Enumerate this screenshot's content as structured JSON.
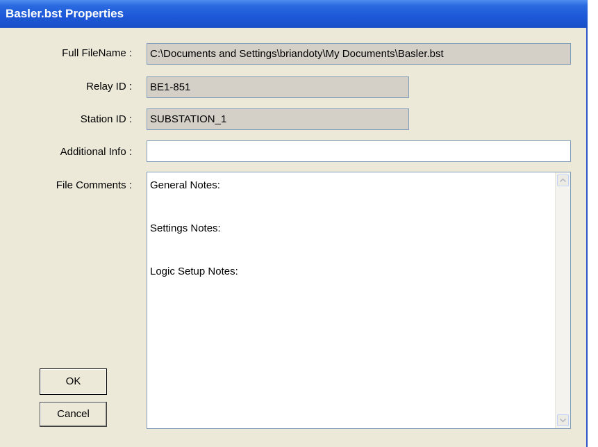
{
  "window": {
    "title": "Basler.bst Properties"
  },
  "fields": {
    "full_filename": {
      "label": "Full FileName :",
      "value": "C:\\Documents and Settings\\briandoty\\My Documents\\Basler.bst"
    },
    "relay_id": {
      "label": "Relay ID :",
      "value": "BE1-851"
    },
    "station_id": {
      "label": "Station ID :",
      "value": "SUBSTATION_1"
    },
    "additional_info": {
      "label": "Additional Info :",
      "value": ""
    },
    "file_comments": {
      "label": "File Comments :",
      "lines": [
        "General Notes:",
        "Settings Notes:",
        "Logic Setup Notes:"
      ]
    }
  },
  "buttons": {
    "ok": "OK",
    "cancel": "Cancel"
  },
  "icons": {
    "scroll_up": "scroll-up-arrow-icon",
    "scroll_down": "scroll-down-arrow-icon"
  }
}
